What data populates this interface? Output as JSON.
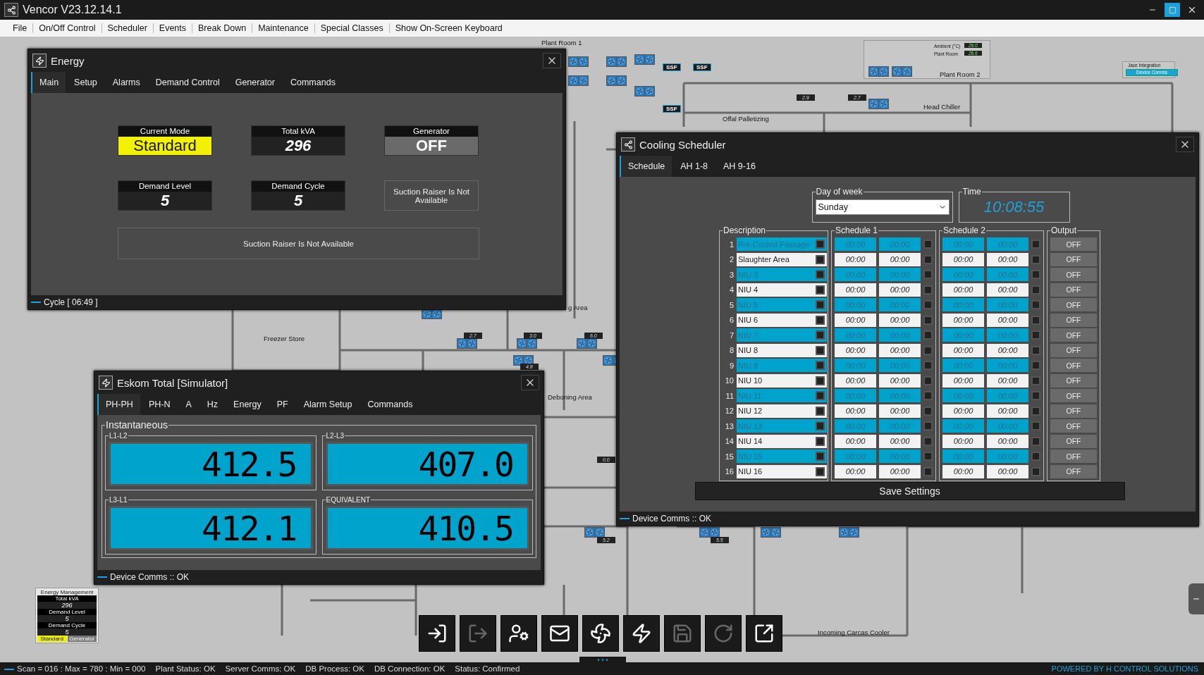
{
  "app": {
    "title": "Vencor V23.12.14.1",
    "menu": [
      "File",
      "On/Off Control",
      "Scheduler",
      "Events",
      "Break Down",
      "Maintenance",
      "Special Classes",
      "Show On-Screen Keyboard"
    ]
  },
  "plan": {
    "areas": [
      "Plant Room 1",
      "Plant Room 2",
      "Head Chiller",
      "Offal Palletizing",
      "Freezer Store",
      "g Area",
      "Deboning Area",
      "Incoming Carcas Cooler"
    ],
    "readings": [
      "2.9",
      "2.7",
      "2.7",
      "3.0",
      "6.0",
      "4.8",
      "0.0",
      "5.2",
      "5.5"
    ],
    "unit_labels": [
      "SSF",
      "SSF",
      "SSF"
    ],
    "ambient": [
      {
        "label": "Ambient (°C)",
        "value": "29.0"
      },
      {
        "label": "Plant Room",
        "value": "26.6"
      }
    ],
    "integration": {
      "label": "Jace Integration",
      "button": "Device Comms"
    }
  },
  "energy": {
    "title": "Energy",
    "tabs": [
      {
        "label": "Main",
        "selected": true
      },
      {
        "label": "Setup",
        "selected": false
      },
      {
        "label": "Alarms",
        "selected": false
      },
      {
        "label": "Demand Control",
        "selected": false
      },
      {
        "label": "Generator",
        "selected": false
      },
      {
        "label": "Commands",
        "selected": false
      }
    ],
    "tiles": [
      {
        "label": "Current Mode",
        "value": "Standard",
        "kind": "mode"
      },
      {
        "label": "Total kVA",
        "value": "296",
        "kind": "reading"
      },
      {
        "label": "Generator",
        "value": "OFF",
        "kind": "state"
      },
      {
        "label": "Demand Level",
        "value": "5",
        "kind": "reading"
      },
      {
        "label": "Demand Cycle",
        "value": "5",
        "kind": "reading"
      },
      {
        "value": "Suction Raiser Is Not Available",
        "kind": "note"
      }
    ],
    "banner": "Suction Raiser Is Not Available",
    "status": "Cycle [ 06:49 ]"
  },
  "eskom": {
    "title": "Eskom Total [Simulator]",
    "tabs": [
      {
        "label": "PH-PH",
        "selected": true
      },
      {
        "label": "PH-N",
        "selected": false
      },
      {
        "label": "A",
        "selected": false
      },
      {
        "label": "Hz",
        "selected": false
      },
      {
        "label": "Energy",
        "selected": false
      },
      {
        "label": "PF",
        "selected": false
      },
      {
        "label": "Alarm Setup",
        "selected": false
      },
      {
        "label": "Commands",
        "selected": false
      }
    ],
    "group": "Instantaneous",
    "meters": [
      {
        "label": "L1-L2",
        "value": "412.5"
      },
      {
        "label": "L2-L3",
        "value": "407.0"
      },
      {
        "label": "L3-L1",
        "value": "412.1"
      },
      {
        "label": "EQUIVALENT",
        "value": "410.5"
      }
    ],
    "status": "Device Comms :: OK"
  },
  "scheduler": {
    "title": "Cooling Scheduler",
    "tabs": [
      {
        "label": "Schedule",
        "selected": true
      },
      {
        "label": "AH 1-8",
        "selected": false
      },
      {
        "label": "AH 9-16",
        "selected": false
      }
    ],
    "day": {
      "label": "Day of week",
      "value": "Sunday"
    },
    "time": {
      "label": "Time",
      "value": "10:08:55"
    },
    "groups": [
      "Description",
      "Schedule 1",
      "Schedule 2",
      "Output"
    ],
    "rows": [
      {
        "no": "1",
        "description": "Pre-Cooled Passage",
        "highlighted": true,
        "checks": [
          false,
          false,
          false
        ],
        "s1": [
          "00:00",
          "00:00"
        ],
        "s2": [
          "00:00",
          "00:00"
        ],
        "output": "OFF"
      },
      {
        "no": "2",
        "description": "Slaughter Area",
        "highlighted": false,
        "checks": [
          false,
          false,
          false
        ],
        "s1": [
          "00:00",
          "00:00"
        ],
        "s2": [
          "00:00",
          "00:00"
        ],
        "output": "OFF"
      },
      {
        "no": "3",
        "description": "NIU 3",
        "highlighted": true,
        "checks": [
          false,
          false,
          false
        ],
        "s1": [
          "00:00",
          "00:00"
        ],
        "s2": [
          "00:00",
          "00:00"
        ],
        "output": "OFF"
      },
      {
        "no": "4",
        "description": "NIU 4",
        "highlighted": false,
        "checks": [
          false,
          false,
          false
        ],
        "s1": [
          "00:00",
          "00:00"
        ],
        "s2": [
          "00:00",
          "00:00"
        ],
        "output": "OFF"
      },
      {
        "no": "5",
        "description": "NIU 5",
        "highlighted": true,
        "checks": [
          false,
          false,
          false
        ],
        "s1": [
          "00:00",
          "00:00"
        ],
        "s2": [
          "00:00",
          "00:00"
        ],
        "output": "OFF"
      },
      {
        "no": "6",
        "description": "NIU 6",
        "highlighted": false,
        "checks": [
          false,
          false,
          false
        ],
        "s1": [
          "00:00",
          "00:00"
        ],
        "s2": [
          "00:00",
          "00:00"
        ],
        "output": "OFF"
      },
      {
        "no": "7",
        "description": "NIU 7",
        "highlighted": true,
        "checks": [
          false,
          false,
          false
        ],
        "s1": [
          "00:00",
          "00:00"
        ],
        "s2": [
          "00:00",
          "00:00"
        ],
        "output": "OFF"
      },
      {
        "no": "8",
        "description": "NIU 8",
        "highlighted": false,
        "checks": [
          false,
          false,
          false
        ],
        "s1": [
          "00:00",
          "00:00"
        ],
        "s2": [
          "00:00",
          "00:00"
        ],
        "output": "OFF"
      },
      {
        "no": "9",
        "description": "NIU 9",
        "highlighted": true,
        "checks": [
          false,
          false,
          false
        ],
        "s1": [
          "00:00",
          "00:00"
        ],
        "s2": [
          "00:00",
          "00:00"
        ],
        "output": "OFF"
      },
      {
        "no": "10",
        "description": "NIU 10",
        "highlighted": false,
        "checks": [
          false,
          false,
          false
        ],
        "s1": [
          "00:00",
          "00:00"
        ],
        "s2": [
          "00:00",
          "00:00"
        ],
        "output": "OFF"
      },
      {
        "no": "11",
        "description": "NIU 11",
        "highlighted": true,
        "checks": [
          false,
          false,
          false
        ],
        "s1": [
          "00:00",
          "00:00"
        ],
        "s2": [
          "00:00",
          "00:00"
        ],
        "output": "OFF"
      },
      {
        "no": "12",
        "description": "NIU 12",
        "highlighted": false,
        "checks": [
          false,
          false,
          false
        ],
        "s1": [
          "00:00",
          "00:00"
        ],
        "s2": [
          "00:00",
          "00:00"
        ],
        "output": "OFF"
      },
      {
        "no": "13",
        "description": "NIU 13",
        "highlighted": true,
        "checks": [
          false,
          false,
          false
        ],
        "s1": [
          "00:00",
          "00:00"
        ],
        "s2": [
          "00:00",
          "00:00"
        ],
        "output": "OFF"
      },
      {
        "no": "14",
        "description": "NIU 14",
        "highlighted": false,
        "checks": [
          false,
          false,
          false
        ],
        "s1": [
          "00:00",
          "00:00"
        ],
        "s2": [
          "00:00",
          "00:00"
        ],
        "output": "OFF"
      },
      {
        "no": "15",
        "description": "NIU 15",
        "highlighted": true,
        "checks": [
          false,
          false,
          false
        ],
        "s1": [
          "00:00",
          "00:00"
        ],
        "s2": [
          "00:00",
          "00:00"
        ],
        "output": "OFF"
      },
      {
        "no": "16",
        "description": "NIU 16",
        "highlighted": false,
        "checks": [
          false,
          false,
          false
        ],
        "s1": [
          "00:00",
          "00:00"
        ],
        "s2": [
          "00:00",
          "00:00"
        ],
        "output": "OFF"
      }
    ],
    "save": "Save Settings",
    "status": "Device Comms :: OK"
  },
  "widget": {
    "title": "Energy Management",
    "lines": [
      {
        "label": "Total kVA",
        "value": "296"
      },
      {
        "label": "Demand Level",
        "value": "5"
      },
      {
        "label": "Demand Cycle",
        "value": "5"
      }
    ],
    "mode": "Standard",
    "generator": "Generator"
  },
  "toolbar": [
    {
      "kind": "login",
      "disabled": false
    },
    {
      "kind": "logout",
      "disabled": true
    },
    {
      "kind": "users",
      "disabled": false
    },
    {
      "kind": "mail",
      "disabled": false
    },
    {
      "kind": "fan",
      "disabled": false
    },
    {
      "kind": "power",
      "disabled": false
    },
    {
      "kind": "save",
      "disabled": true
    },
    {
      "kind": "refresh",
      "disabled": true
    },
    {
      "kind": "popout",
      "disabled": false
    }
  ],
  "status_bar": {
    "items": [
      "Scan = 016 : Max = 780 : Min = 000",
      "Plant Status: OK",
      "Server Comms: OK",
      "DB Process:  OK",
      "DB Connection:  OK",
      "Status:  Confirmed"
    ],
    "brand": "POWERED BY H CONTROL SOLUTIONS"
  }
}
